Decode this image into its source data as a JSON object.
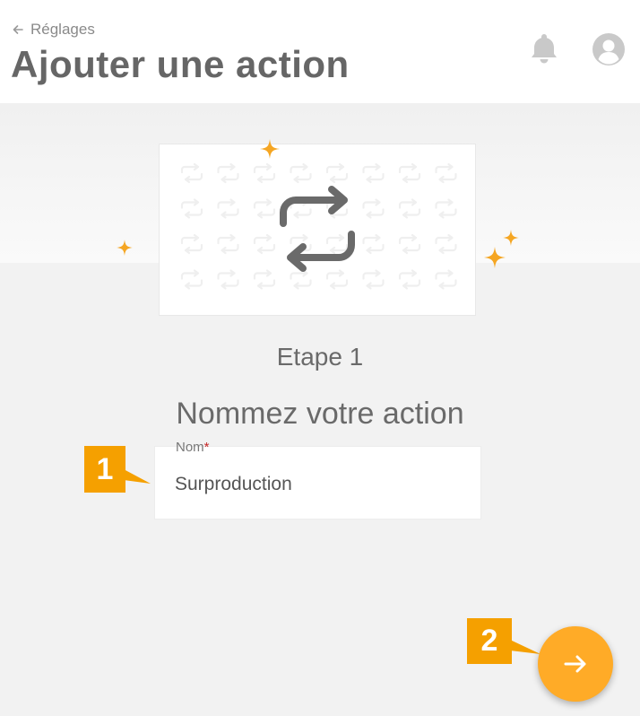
{
  "header": {
    "back_label": "Réglages",
    "title": "Ajouter une action",
    "icons": [
      "arrow-left-icon",
      "bell-icon",
      "user-avatar-icon"
    ]
  },
  "illustration": {
    "icon": "repeat-arrows-icon",
    "pattern_icon": "repeat-arrows-icon",
    "sparkle_icon": "sparkle-icon"
  },
  "step": {
    "label": "Etape 1",
    "title": "Nommez votre action"
  },
  "form": {
    "name_label": "Nom",
    "required_mark": "*",
    "name_value": "Surproduction"
  },
  "callouts": {
    "first": "1",
    "second": "2"
  },
  "fab": {
    "icon": "arrow-right-icon"
  },
  "colors": {
    "accent": "#ffab27",
    "callout": "#f5a000",
    "text": "#666666",
    "required": "#c62828"
  }
}
